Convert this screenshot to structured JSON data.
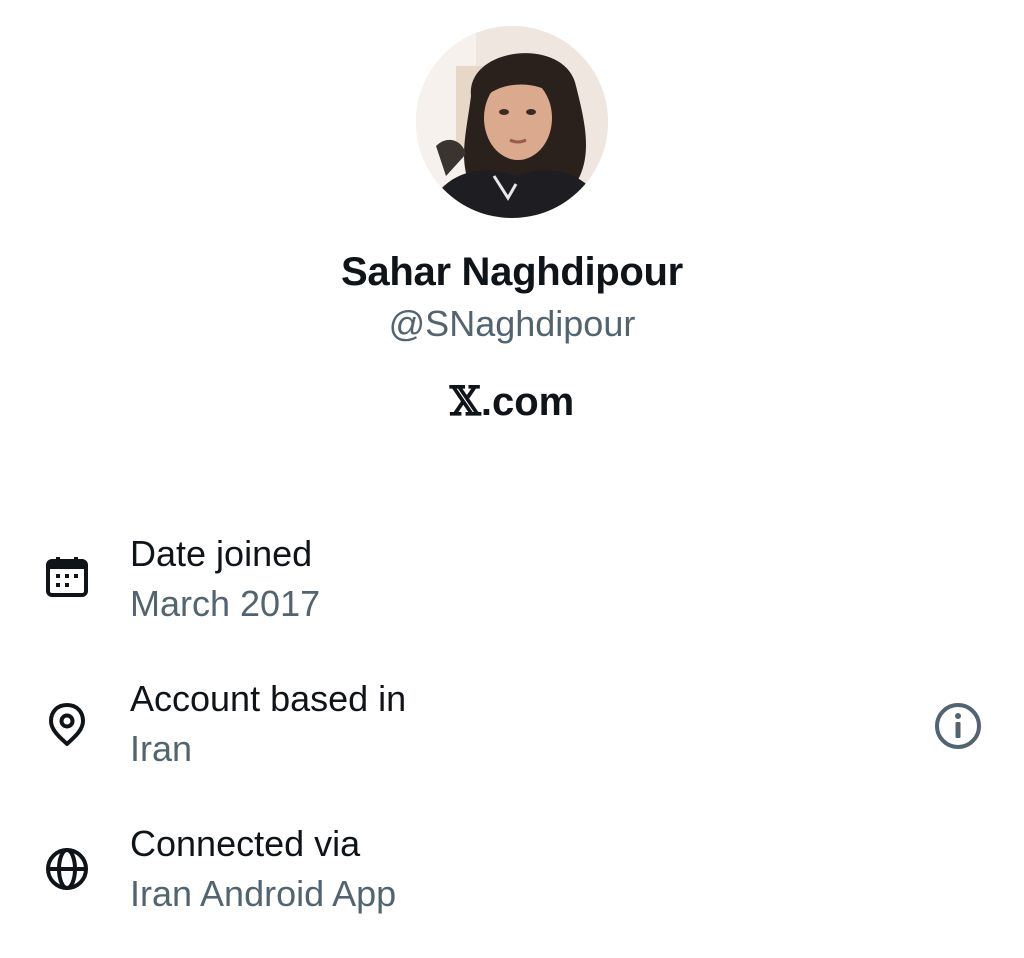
{
  "profile": {
    "display_name": "Sahar Naghdipour",
    "handle": "@SNaghdipour",
    "site_prefix": "𝕏",
    "site_suffix": ".com"
  },
  "details": [
    {
      "icon": "calendar-icon",
      "label": "Date joined",
      "value": "March 2017"
    },
    {
      "icon": "location-pin-icon",
      "label": "Account based in",
      "value": "Iran"
    },
    {
      "icon": "globe-icon",
      "label": "Connected via",
      "value": "Iran Android App"
    }
  ],
  "colors": {
    "primary_text": "#0f1419",
    "secondary_text": "#536471",
    "background": "#ffffff"
  }
}
